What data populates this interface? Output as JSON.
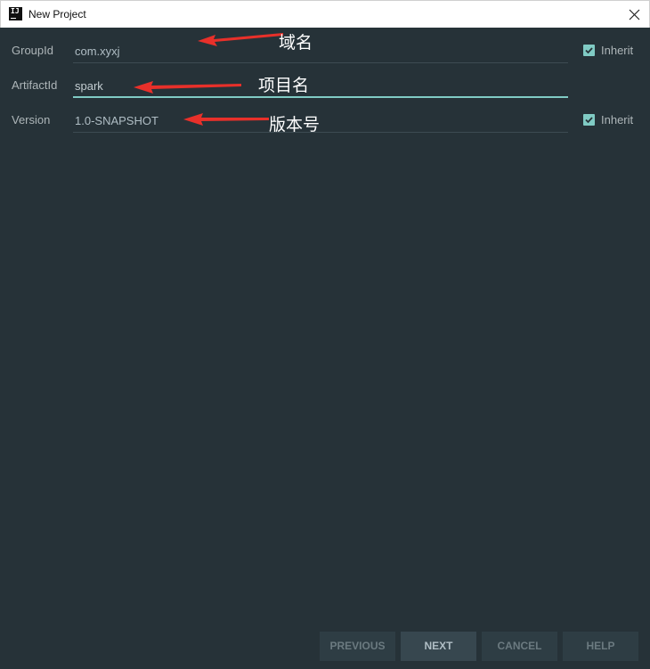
{
  "window": {
    "title": "New Project",
    "icon_text": "IJ"
  },
  "form": {
    "group_id": {
      "label": "GroupId",
      "value": "com.xyxj",
      "inherit_label": "Inherit",
      "inherit_checked": true
    },
    "artifact_id": {
      "label": "ArtifactId",
      "value": "spark"
    },
    "version": {
      "label": "Version",
      "value": "1.0-SNAPSHOT",
      "inherit_label": "Inherit",
      "inherit_checked": true
    }
  },
  "annotations": {
    "group_id_note": "域名",
    "artifact_id_note": "项目名",
    "version_note": "版本号",
    "arrow_color": "#e8302a"
  },
  "buttons": {
    "previous": "PREVIOUS",
    "next": "NEXT",
    "cancel": "CANCEL",
    "help": "HELP"
  },
  "colors": {
    "background": "#263238",
    "accent": "#80cbc4",
    "text": "#b0bec5"
  }
}
